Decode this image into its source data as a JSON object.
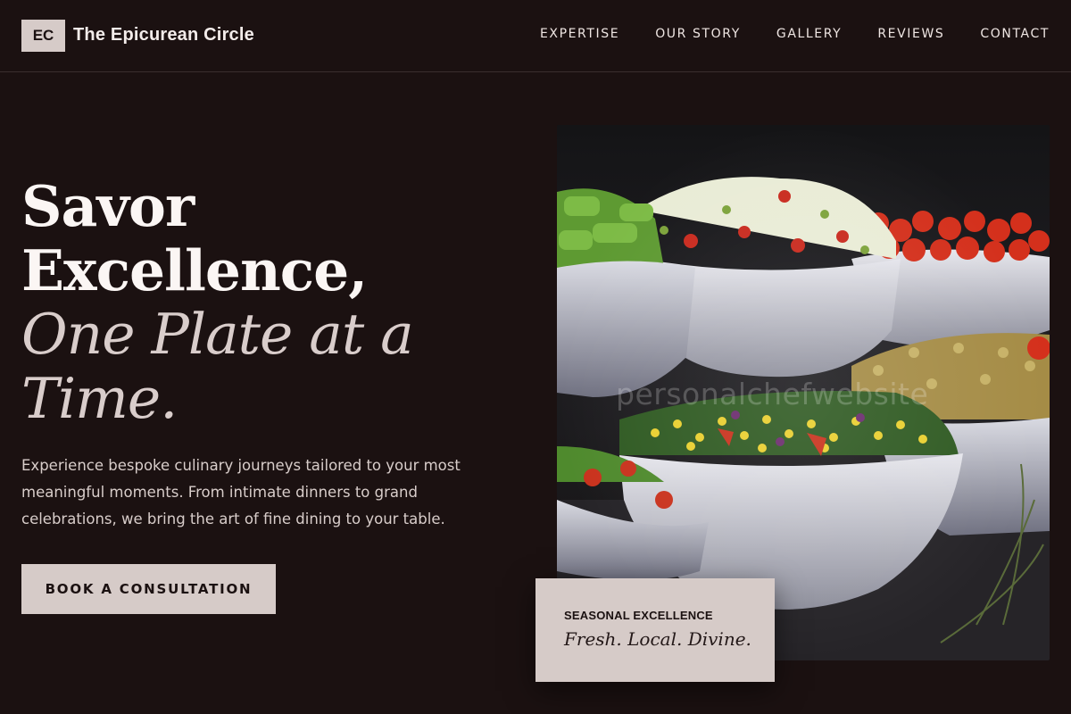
{
  "header": {
    "logo_initials": "EC",
    "brand_name": "The Epicurean Circle",
    "nav": [
      "EXPERTISE",
      "OUR STORY",
      "GALLERY",
      "REVIEWS",
      "CONTACT"
    ]
  },
  "hero": {
    "title_line1": "Savor",
    "title_line2": "Excellence,",
    "title_accent_line1": "One Plate at a",
    "title_accent_line2": "Time.",
    "description": "Experience bespoke culinary journeys tailored to your most meaningful moments. From intimate dinners to grand celebrations, we bring the art of fine dining to your table.",
    "cta_label": "BOOK A CONSULTATION"
  },
  "photo": {
    "watermark": "personalchefwebsite"
  },
  "card": {
    "label": "SEASONAL EXCELLENCE",
    "tagline": "Fresh. Local. Divine."
  },
  "colors": {
    "background": "#1b1111",
    "accent": "#d6cbc8",
    "text": "#f3ecea"
  }
}
